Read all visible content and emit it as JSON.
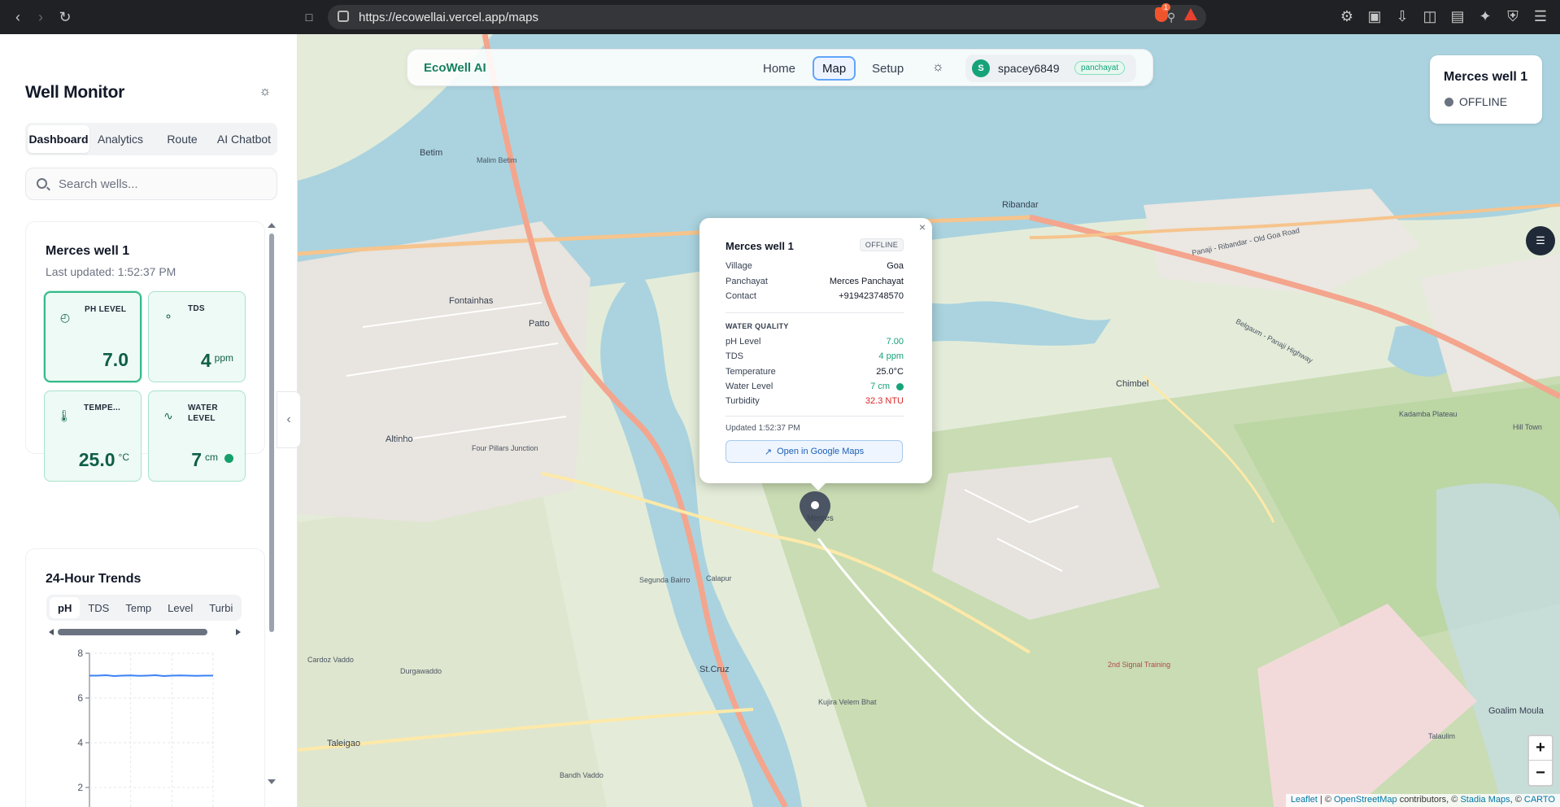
{
  "browser": {
    "url": "https://ecowellai.vercel.app/maps",
    "brave_badge": "1"
  },
  "sidebar": {
    "title": "Well Monitor",
    "tabs": [
      "Dashboard",
      "Analytics",
      "Route",
      "AI Chatbot"
    ],
    "search_placeholder": "Search wells...",
    "well_card": {
      "title": "Merces well 1",
      "updated": "Last updated: 1:52:37 PM",
      "metrics": [
        {
          "label": "PH LEVEL",
          "value": "7.0",
          "unit": ""
        },
        {
          "label": "TDS",
          "value": "4",
          "unit": "ppm"
        },
        {
          "label": "TEMPE...",
          "value": "25.0",
          "unit": "°C"
        },
        {
          "label": "WATER LEVEL",
          "value": "7",
          "unit": "cm"
        }
      ]
    },
    "trends": {
      "title": "24-Hour Trends",
      "tabs": [
        "pH",
        "TDS",
        "Temp",
        "Level",
        "Turbi"
      ]
    }
  },
  "chart_data": {
    "type": "line",
    "title": "24-Hour Trends",
    "yticks": [
      "8",
      "6",
      "4",
      "2"
    ],
    "ylim": [
      0,
      8
    ],
    "series": [
      {
        "values": [
          7.0,
          7.0,
          7.02,
          6.98,
          7.0,
          7.01,
          6.99,
          7.0,
          7.02,
          6.98,
          7.0,
          7.01,
          7.0,
          6.99,
          7.0,
          7.0
        ]
      }
    ],
    "grid": true
  },
  "nav": {
    "brand": "EcoWell AI",
    "links": [
      "Home",
      "Map",
      "Setup"
    ],
    "user_initial": "S",
    "username": "spacey6849",
    "role": "panchayat"
  },
  "status_box": {
    "title": "Merces well 1",
    "status": "OFFLINE"
  },
  "popup": {
    "title": "Merces well 1",
    "badge": "OFFLINE",
    "info": [
      {
        "k": "Village",
        "v": "Goa"
      },
      {
        "k": "Panchayat",
        "v": "Merces Panchayat"
      },
      {
        "k": "Contact",
        "v": "+919423748570"
      }
    ],
    "quality_heading": "WATER QUALITY",
    "quality": [
      {
        "k": "pH Level",
        "v": "7.00"
      },
      {
        "k": "TDS",
        "v": "4 ppm"
      },
      {
        "k": "Temperature",
        "v": "25.0°C"
      },
      {
        "k": "Water Level",
        "v": "7 cm"
      },
      {
        "k": "Turbidity",
        "v": "32.3 NTU"
      }
    ],
    "updated": "Updated 1:52:37 PM",
    "button": "Open in Google Maps"
  },
  "map_labels": [
    "Ribandar",
    "Chimbel",
    "Altinho",
    "Fontainhas",
    "Patto",
    "St.Cruz",
    "Taleigao",
    "Merces",
    "Calapur",
    "Goalim Moula",
    "Talaulim",
    "Betim",
    "Malim Betim",
    "Segunda Bairro",
    "Kujira Velem Bhat",
    "Durgawaddo",
    "Cardoz Vaddo",
    "Four Pillars Junction",
    "2nd Signal Training",
    "Bandh Vaddo",
    "Hill Town",
    "Kadamba Plateau",
    "Belgaum - Panaji Highway",
    "Panaji - Ribandar - Old Goa Road"
  ],
  "zoom": {
    "in": "+",
    "out": "−"
  },
  "attribution": {
    "leaflet": "Leaflet",
    "rest": " | © ",
    "osm": "OpenStreetMap",
    "contrib": " contributors, © ",
    "stadia": "Stadia Maps",
    "carto_sep": ", © ",
    "carto": "CARTO"
  }
}
